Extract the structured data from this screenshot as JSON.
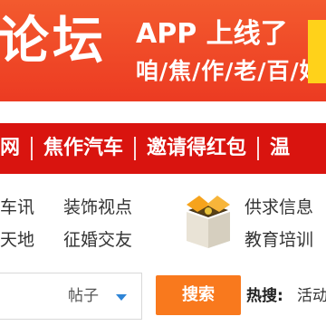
{
  "banner": {
    "title": "论坛",
    "headline": "APP 上线了",
    "subline": "咱/焦/作/老/百/姓"
  },
  "nav": {
    "items": [
      "网",
      "焦作汽车",
      "邀请得红包",
      "温"
    ]
  },
  "links": {
    "col1": [
      "车讯",
      "天地"
    ],
    "col2": [
      "装饰视点",
      "征婚交友"
    ],
    "col3": [
      "供求信息",
      "教育培训"
    ]
  },
  "search": {
    "type_label": "帖子",
    "button_label": "搜索",
    "hot_label": "热搜:",
    "hot_item": "活动"
  },
  "colors": {
    "banner": "#ec3b22",
    "nav": "#d9140f",
    "search_button": "#f9791d",
    "caret": "#2e84d6"
  }
}
